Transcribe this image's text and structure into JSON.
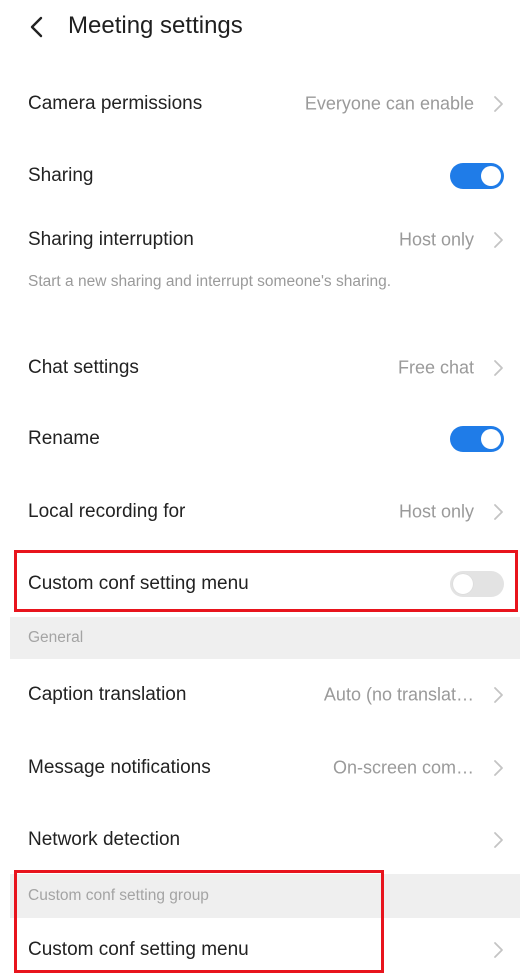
{
  "header": {
    "title": "Meeting settings",
    "back_icon": "chevron-left-icon"
  },
  "colors": {
    "toggle_on": "#1f7ce8",
    "toggle_off": "#e3e3e3",
    "highlight": "#e8141d",
    "secondary_text": "#9a9a9a",
    "section_bg": "#efefef"
  },
  "settings": {
    "camera_permissions": {
      "label": "Camera permissions",
      "value": "Everyone can enable"
    },
    "sharing": {
      "label": "Sharing",
      "enabled": true
    },
    "sharing_interruption": {
      "label": "Sharing interruption",
      "value": "Host only",
      "description": "Start a new sharing and interrupt someone's sharing."
    },
    "chat_settings": {
      "label": "Chat settings",
      "value": "Free chat"
    },
    "rename": {
      "label": "Rename",
      "enabled": true
    },
    "local_recording": {
      "label": "Local recording for",
      "value": "Host only"
    },
    "custom_conf_toggle": {
      "label": "Custom conf setting menu",
      "enabled": false
    }
  },
  "general": {
    "section_label": "General",
    "caption_translation": {
      "label": "Caption translation",
      "value": "Auto (no translat…"
    },
    "message_notifications": {
      "label": "Message notifications",
      "value": "On-screen com…"
    },
    "network_detection": {
      "label": "Network detection"
    }
  },
  "custom_group": {
    "section_label": "Custom conf setting group",
    "menu": {
      "label": "Custom conf setting menu"
    }
  }
}
